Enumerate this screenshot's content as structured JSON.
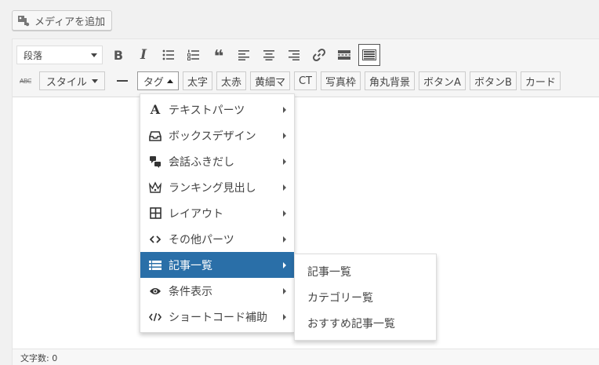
{
  "media": {
    "label": "メディアを追加"
  },
  "toolbar": {
    "format_select": "段落",
    "bold": "B",
    "italic": "I",
    "blockquote": "❝",
    "style_label": "スタイル",
    "tag_label": "タグ",
    "quick_tags": [
      "太字",
      "太赤",
      "黄細マ",
      "CT",
      "写真枠",
      "角丸背景",
      "ボタンA",
      "ボタンB",
      "カード"
    ]
  },
  "menu": {
    "items": [
      {
        "icon": "font-icon",
        "label": "テキストパーツ"
      },
      {
        "icon": "inbox-icon",
        "label": "ボックスデザイン"
      },
      {
        "icon": "speech-bubbles-icon",
        "label": "会話ふきだし"
      },
      {
        "icon": "crown-icon",
        "label": "ランキング見出し"
      },
      {
        "icon": "grid-icon",
        "label": "レイアウト"
      },
      {
        "icon": "code-brackets-icon",
        "label": "その他パーツ"
      },
      {
        "icon": "list-icon",
        "label": "記事一覧"
      },
      {
        "icon": "eye-icon",
        "label": "条件表示"
      },
      {
        "icon": "code-slash-icon",
        "label": "ショートコード補助"
      }
    ],
    "selected_index": 6
  },
  "submenu": {
    "items": [
      "記事一覧",
      "カテゴリー覧",
      "おすすめ記事一覧"
    ]
  },
  "status": {
    "word_count": "文字数: 0"
  },
  "colors": {
    "selected": "#2a6fa8",
    "toolbar_bg": "#f5f5f5"
  }
}
